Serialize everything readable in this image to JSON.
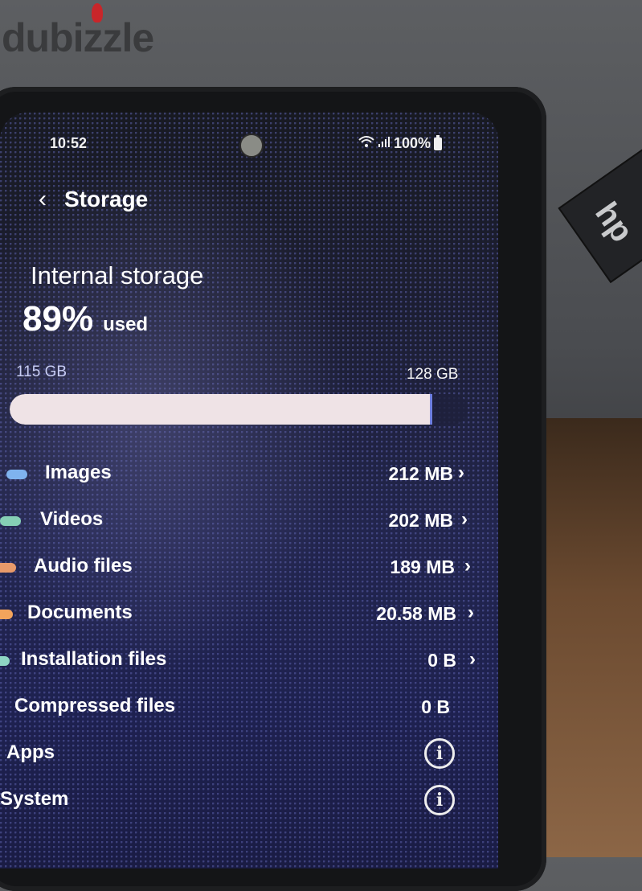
{
  "watermark": {
    "text": "dubizzle"
  },
  "status_bar": {
    "time": "10:52",
    "battery": "100%",
    "wifi_icon": "wifi-icon",
    "signal_icon": "signal-icon"
  },
  "header": {
    "back_icon": "chevron-left-icon",
    "title": "Storage"
  },
  "storage": {
    "label": "Internal storage",
    "used_percent_label": "89%",
    "used_word": "used",
    "used_percent": 89,
    "used_amount": "115 GB",
    "total_amount": "128 GB"
  },
  "categories": [
    {
      "label": "Images",
      "value": "212 MB",
      "color": "#7fb3ef",
      "has_chevron": true
    },
    {
      "label": "Videos",
      "value": "202 MB",
      "color": "#86cfb5",
      "has_chevron": true
    },
    {
      "label": "Audio files",
      "value": "189 MB",
      "color": "#e89a6a",
      "has_chevron": true
    },
    {
      "label": "Documents",
      "value": "20.58 MB",
      "color": "#f3a45c",
      "has_chevron": true
    },
    {
      "label": "Installation files",
      "value": "0 B",
      "color": "#8fd6c4",
      "has_chevron": true
    },
    {
      "label": "Compressed files",
      "value": "0 B",
      "color": null,
      "has_chevron": false
    },
    {
      "label": "Apps",
      "value": null,
      "icon": "info-icon"
    },
    {
      "label": "System",
      "value": null,
      "icon": "info-icon"
    }
  ],
  "chevron": "›",
  "info_glyph": "i"
}
